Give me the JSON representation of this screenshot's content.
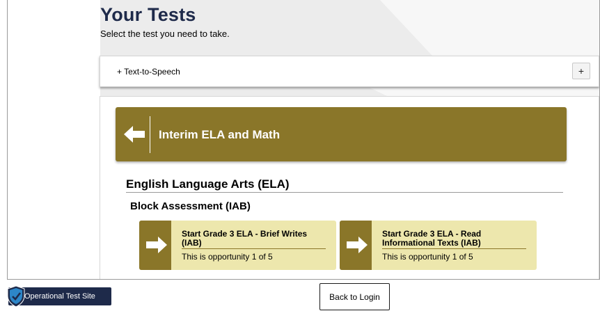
{
  "page": {
    "title": "Your Tests",
    "subtitle": "Select the test you need to take."
  },
  "accessibility": {
    "tts_label": "+ Text-to-Speech",
    "tts_toggle": "+"
  },
  "test_group": {
    "title": "Interim ELA and Math",
    "back_icon": "arrow-left-icon"
  },
  "subject": {
    "title": "English Language Arts (ELA)",
    "category": "Block Assessment (IAB)"
  },
  "tests": [
    {
      "name": "Start Grade 3 ELA - Brief Writes (IAB)",
      "opportunity": "This is opportunity 1 of 5",
      "icon": "arrow-right-icon"
    },
    {
      "name": "Start Grade 3 ELA - Read Informational Texts (IAB)",
      "opportunity": "This is opportunity 1 of 5",
      "icon": "arrow-right-icon"
    }
  ],
  "footer": {
    "site_label": "Operational Test Site",
    "site_icon": "shield-check-icon",
    "back_to_login": "Back to Login"
  },
  "colors": {
    "brand_navy": "#1e2a4a",
    "tile_gold": "#8a7629",
    "tile_bg": "#ede7ad",
    "badge_check": "#2d86c8"
  }
}
